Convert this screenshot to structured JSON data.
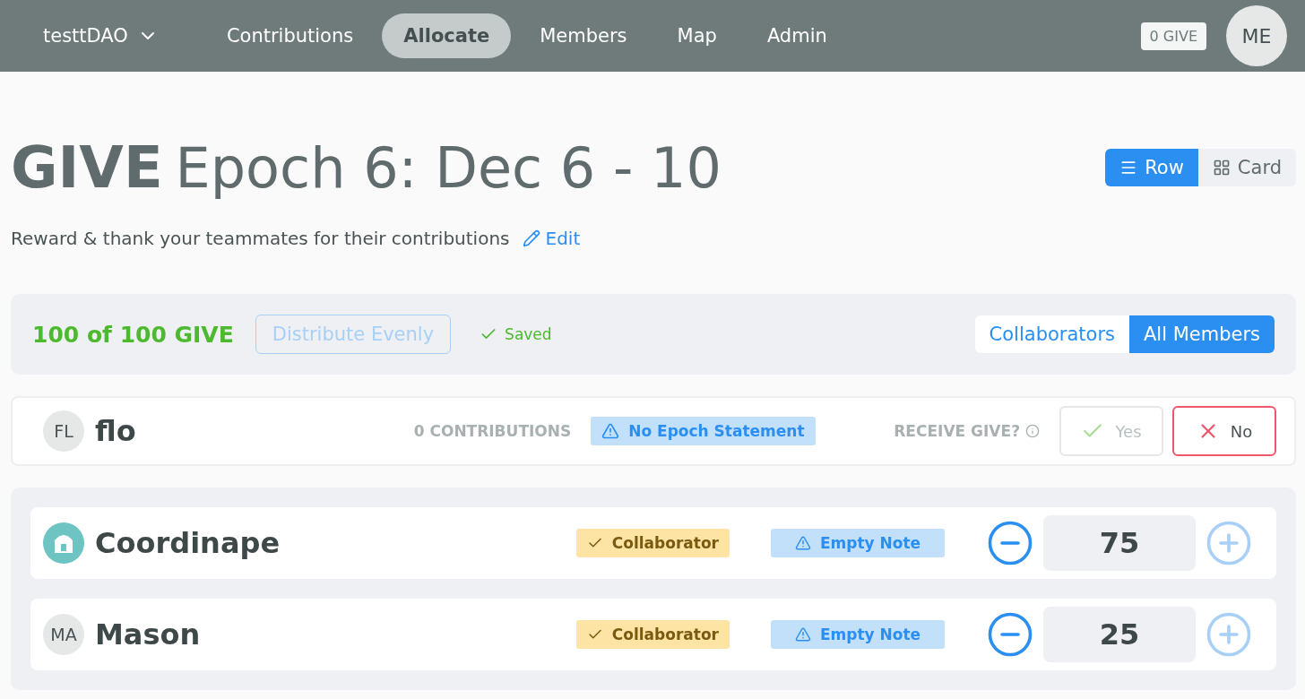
{
  "nav": {
    "org": "testtDAO",
    "items": [
      {
        "label": "Contributions",
        "selected": false
      },
      {
        "label": "Allocate",
        "selected": true
      },
      {
        "label": "Members",
        "selected": false
      },
      {
        "label": "Map",
        "selected": false
      },
      {
        "label": "Admin",
        "selected": false
      }
    ],
    "balance": "0 GIVE",
    "avatar": "ME"
  },
  "header": {
    "token": "GIVE",
    "title": "Epoch 6: Dec 6 - 10",
    "subtitle": "Reward & thank your teammates for their contributions",
    "edit": "Edit",
    "views": [
      {
        "label": "Row",
        "kind": "rows",
        "selected": true
      },
      {
        "label": "Card",
        "kind": "grid",
        "selected": false
      }
    ]
  },
  "summary": {
    "allocated": "100 of 100 GIVE",
    "distribute": "Distribute Evenly",
    "distribute_disabled": true,
    "status": "Saved",
    "filters": [
      {
        "label": "Collaborators",
        "selected": false
      },
      {
        "label": "All Members",
        "selected": true
      }
    ]
  },
  "me": {
    "initials": "FL",
    "name": "flo",
    "contributions": "0 CONTRIBUTIONS",
    "statement": "No Epoch Statement",
    "receive_label": "RECEIVE GIVE?",
    "choices": [
      {
        "label": "Yes",
        "kind": "yes",
        "selected": false
      },
      {
        "label": "No",
        "kind": "no",
        "selected": true
      }
    ]
  },
  "members": [
    {
      "name": "Coordinape",
      "kind": "logo",
      "tag": "Collaborator",
      "note": "Empty Note",
      "amount": "75",
      "plus_disabled": true
    },
    {
      "name": "Mason",
      "kind": "initials",
      "initials": "MA",
      "tag": "Collaborator",
      "note": "Empty Note",
      "amount": "25",
      "plus_disabled": true
    }
  ]
}
